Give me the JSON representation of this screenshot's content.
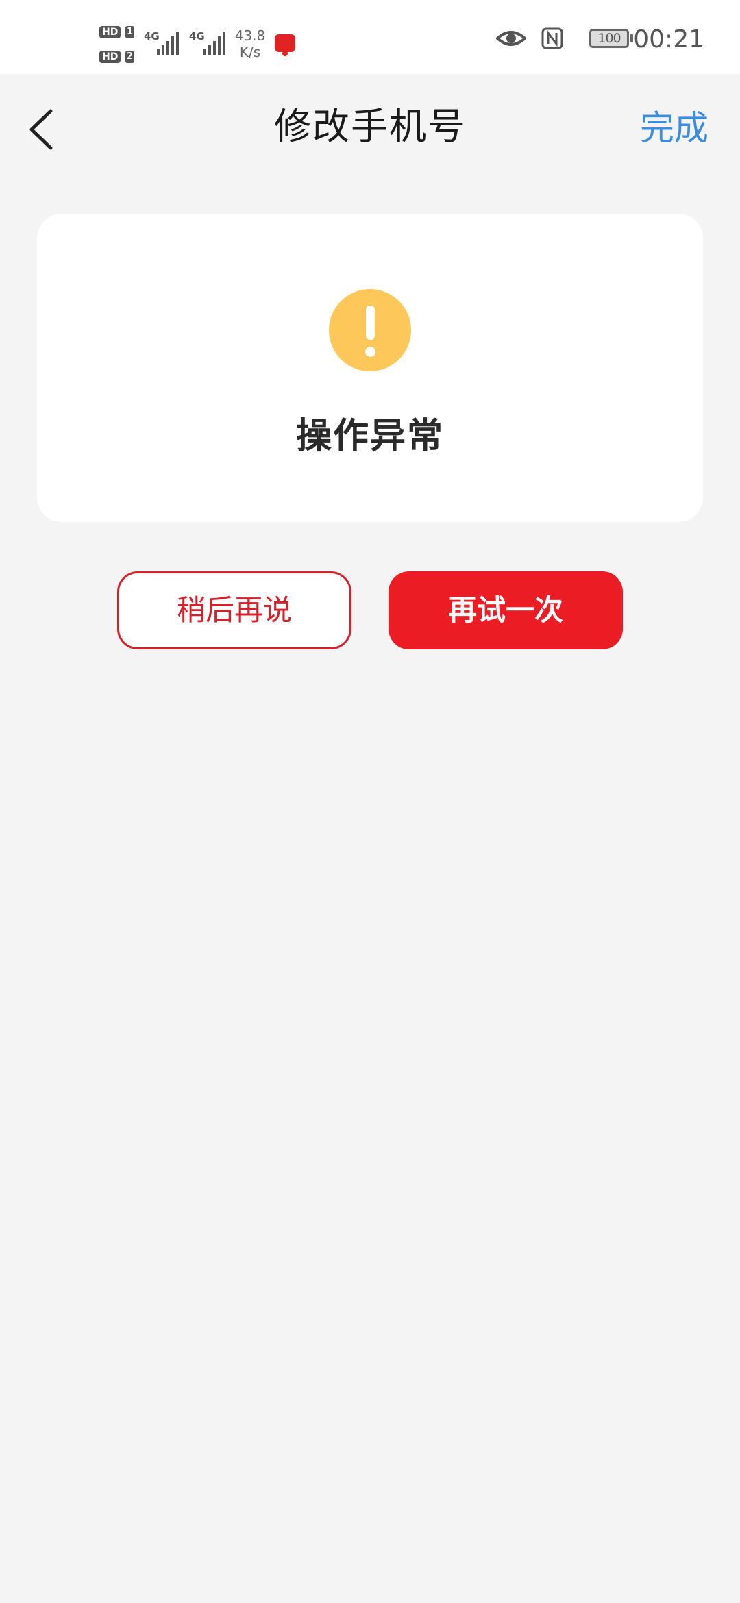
{
  "status_bar": {
    "sim1_hd": "HD",
    "sim1_num": "1",
    "sim2_hd": "HD",
    "sim2_num": "2",
    "net1": "4G",
    "net2": "4G",
    "speed_value": "43.8",
    "speed_unit": "K/s",
    "battery": "100",
    "time": "00:21"
  },
  "nav": {
    "title": "修改手机号",
    "done_label": "完成"
  },
  "card": {
    "message": "操作异常"
  },
  "buttons": {
    "later_label": "稍后再说",
    "retry_label": "再试一次"
  },
  "colors": {
    "accent_blue": "#3a8de0",
    "primary_red": "#ec1c24",
    "warning_yellow": "#fdc75a",
    "background": "#f4f4f5"
  }
}
